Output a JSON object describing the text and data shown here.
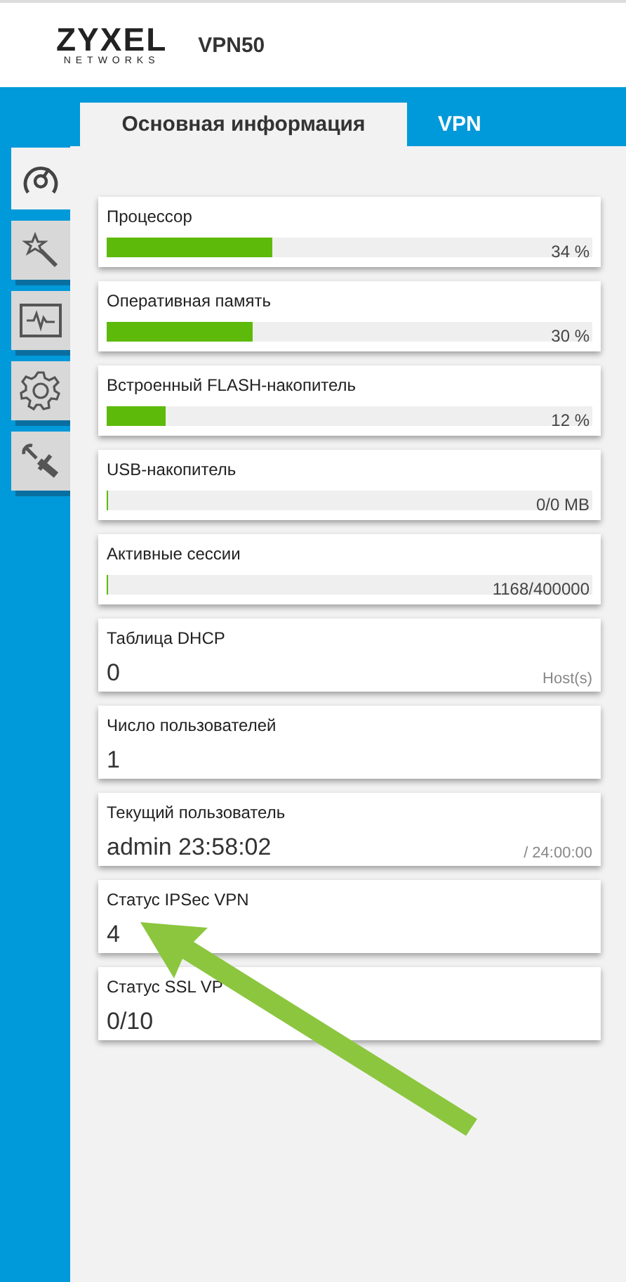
{
  "header": {
    "logo": "ZYXEL",
    "logo_sub": "NETWORKS",
    "model": "VPN50"
  },
  "tabs": [
    {
      "label": "Основная информация",
      "selected": true
    },
    {
      "label": "VPN",
      "selected": false
    }
  ],
  "sidebar": {
    "items": [
      {
        "kind": "gauge",
        "selected": true
      },
      {
        "kind": "wand",
        "selected": false
      },
      {
        "kind": "monitor",
        "selected": false
      },
      {
        "kind": "gear",
        "selected": false
      },
      {
        "kind": "tools",
        "selected": false
      }
    ]
  },
  "cards": [
    {
      "kind": "bar",
      "title": "Процессор",
      "level": 0.34,
      "reading": "34 %"
    },
    {
      "kind": "bar",
      "title": "Оперативная память",
      "level": 0.3,
      "reading": "30 %"
    },
    {
      "kind": "bar",
      "title": "Встроенный FLASH-накопитель",
      "level": 0.12,
      "reading": "12 %"
    },
    {
      "kind": "bar",
      "title": "USB-накопитель",
      "level": 0,
      "reading": "0/0 MB"
    },
    {
      "kind": "bar",
      "title": "Активные сессии",
      "level": 0.003,
      "reading": "1168/400000"
    },
    {
      "kind": "value",
      "title": "Таблица DHCP",
      "value": "0",
      "unit": "Host(s)"
    },
    {
      "kind": "value",
      "title": "Число пользователей",
      "value": "1"
    },
    {
      "kind": "value",
      "title": "Текущий пользователь",
      "value": "admin 23:58:02",
      "unit": "/ 24:00:00"
    },
    {
      "kind": "value",
      "title": "Статус IPSec VPN",
      "value": "4"
    },
    {
      "kind": "value",
      "title": "Статус SSL VP",
      "value": "0/10"
    }
  ]
}
